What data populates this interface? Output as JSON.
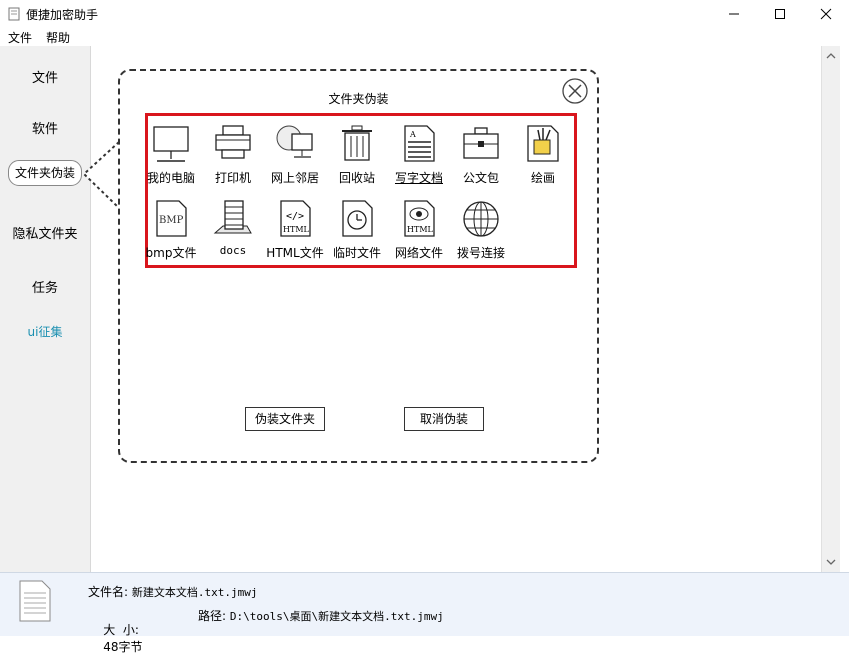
{
  "window": {
    "title": "便捷加密助手"
  },
  "menu": [
    "文件",
    "帮助"
  ],
  "sidebar": {
    "items": [
      {
        "label": "文件"
      },
      {
        "label": "软件"
      },
      {
        "label": "文件夹伪装"
      },
      {
        "label": "隐私文件夹"
      },
      {
        "label": "任务"
      },
      {
        "label": "ui征集"
      }
    ],
    "active": "文件夹伪装"
  },
  "dialog": {
    "title": "文件夹伪装",
    "icons": [
      {
        "label": "我的电脑",
        "icon": "computer-icon"
      },
      {
        "label": "打印机",
        "icon": "printer-icon"
      },
      {
        "label": "网上邻居",
        "icon": "network-neighborhood-icon"
      },
      {
        "label": "回收站",
        "icon": "recycle-bin-icon"
      },
      {
        "label": "写字文档",
        "icon": "text-document-icon"
      },
      {
        "label": "公文包",
        "icon": "briefcase-icon"
      },
      {
        "label": "绘画",
        "icon": "paint-icon"
      },
      {
        "label": "bmp文件",
        "icon": "bmp-file-icon"
      },
      {
        "label": "docs",
        "icon": "docs-stack-icon"
      },
      {
        "label": "HTML文件",
        "icon": "html-file-icon"
      },
      {
        "label": "临时文件",
        "icon": "temp-file-icon"
      },
      {
        "label": "网络文件",
        "icon": "network-file-icon"
      },
      {
        "label": "拨号连接",
        "icon": "globe-icon"
      }
    ],
    "disguise_button": "伪装文件夹",
    "cancel_button": "取消伪装",
    "highlight_color": "#d9161d"
  },
  "status": {
    "filename_label": "文件名:",
    "filename": "新建文本文档.txt.jmwj",
    "size_label": "大  小:",
    "size": "48字节",
    "path_label": "路径:",
    "path": "D:\\tools\\桌面\\新建文本文档.txt.jmwj"
  }
}
